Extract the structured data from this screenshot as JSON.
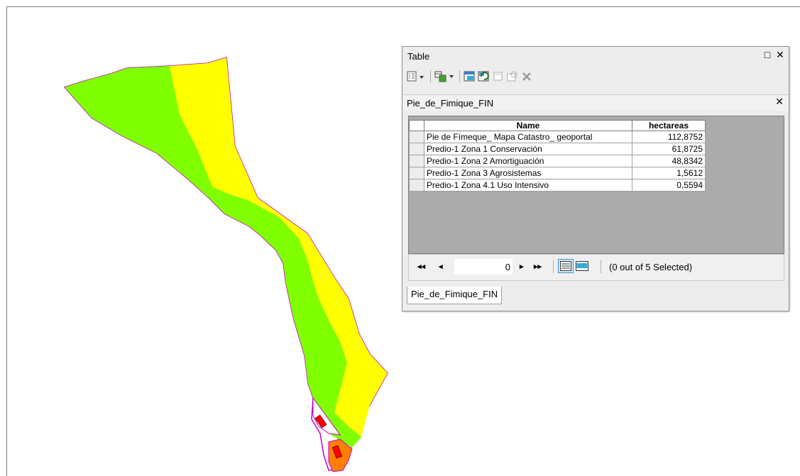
{
  "window": {
    "title": "Table",
    "restore_label": "□",
    "close_label": "✕"
  },
  "toolbar": {
    "buttons": [
      {
        "icon": "table-options-icon"
      },
      {
        "icon": "related-tables-icon"
      },
      {
        "icon": "select-by-attributes-icon"
      },
      {
        "icon": "switch-selection-icon"
      },
      {
        "icon": "clear-selection-icon"
      },
      {
        "icon": "zoom-to-selected-icon"
      },
      {
        "icon": "delete-selected-icon"
      }
    ]
  },
  "layer_tab": {
    "label": "Pie_de_Fimique_FIN",
    "close_label": "✕"
  },
  "attribute_table": {
    "columns": [
      "Name",
      "hectareas"
    ],
    "rows": [
      {
        "name": "Pie de Fímeque_ Mapa Catastro_ geoportal",
        "hectareas": "112,8752"
      },
      {
        "name": "Predio-1 Zona 1 Conservación",
        "hectareas": "61,8725"
      },
      {
        "name": "Predio-1 Zona 2 Amortiguación",
        "hectareas": "48,8342"
      },
      {
        "name": "Predio-1 Zona 3 Agrosistemas",
        "hectareas": "1,5612"
      },
      {
        "name": "Predio-1 Zona 4.1 Uso Intensivo",
        "hectareas": "0,5594"
      }
    ]
  },
  "navigation": {
    "first_label": "◂◂",
    "prev_label": "◂",
    "next_label": "▸",
    "last_label": "▸▸",
    "record_value": "0",
    "selection_status": "(0 out of 5 Selected)"
  },
  "bottom_tab": {
    "label": "Pie_de_Fimique_FIN"
  },
  "colors": {
    "conservation_zone": "#80ff00",
    "buffer_zone": "#ffff00",
    "agro_zone": "#ff8000",
    "intensive_use": "#ff0000",
    "parcel_outline": "#c800c8"
  }
}
